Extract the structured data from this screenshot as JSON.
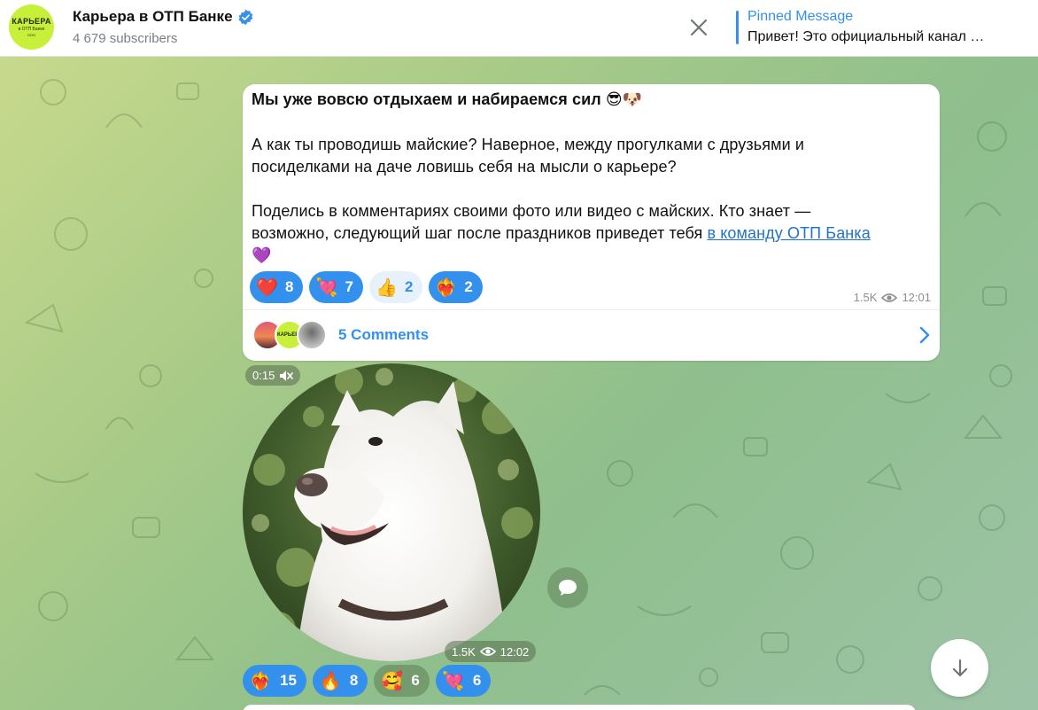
{
  "channel": {
    "name": "Карьера в ОТП Банке",
    "subscribers": "4 679 subscribers",
    "avatar_line1": "КАРЬЕРА",
    "avatar_line2": "в ОТП Банке",
    "avatar_line3": "ООО"
  },
  "pinned": {
    "label": "Pinned Message",
    "text": "Привет! Это официальный канал …"
  },
  "message": {
    "line1": "Мы уже вовсю отдыхаем и набираемся сил 😎🐶",
    "line2": "А как ты проводишь майские? Наверное, между прогулками с друзьями и",
    "line3": "посиделками на даче ловишь себя на мысли о карьере?",
    "line4": "Поделись в комментариях своими фото или видео с майских. Кто знает —",
    "line5_text": "возможно, следующий шаг после праздников приведет тебя ",
    "line5_link": "в команду ОТП Банка",
    "line6": "💜",
    "reactions": [
      {
        "emoji": "❤️",
        "count": "8",
        "style": "blue"
      },
      {
        "emoji": "💘",
        "count": "7",
        "style": "blue"
      },
      {
        "emoji": "👍",
        "count": "2",
        "style": "light"
      },
      {
        "emoji": "❤️‍🔥",
        "count": "2",
        "style": "blue"
      }
    ],
    "views": "1.5K",
    "time": "12:01",
    "comments_label": "5 Comments",
    "comment_avatar_text": "КАРЬЕРА"
  },
  "video": {
    "duration": "0:15",
    "views": "1.5K",
    "time": "12:02",
    "reactions": [
      {
        "emoji": "❤️‍🔥",
        "count": "15",
        "style": "blue"
      },
      {
        "emoji": "🔥",
        "count": "8",
        "style": "blue"
      },
      {
        "emoji": "🥰",
        "count": "6",
        "style": "alt"
      },
      {
        "emoji": "💘",
        "count": "6",
        "style": "blue"
      }
    ]
  },
  "colors": {
    "accent": "#3390ec",
    "link": "#1f74c6",
    "avatar_bg": "#c8f03b"
  },
  "icons": [
    "verified-icon",
    "close-icon",
    "eye-icon",
    "chevron-right-icon",
    "mute-icon",
    "comment-icon",
    "arrow-down-icon"
  ]
}
